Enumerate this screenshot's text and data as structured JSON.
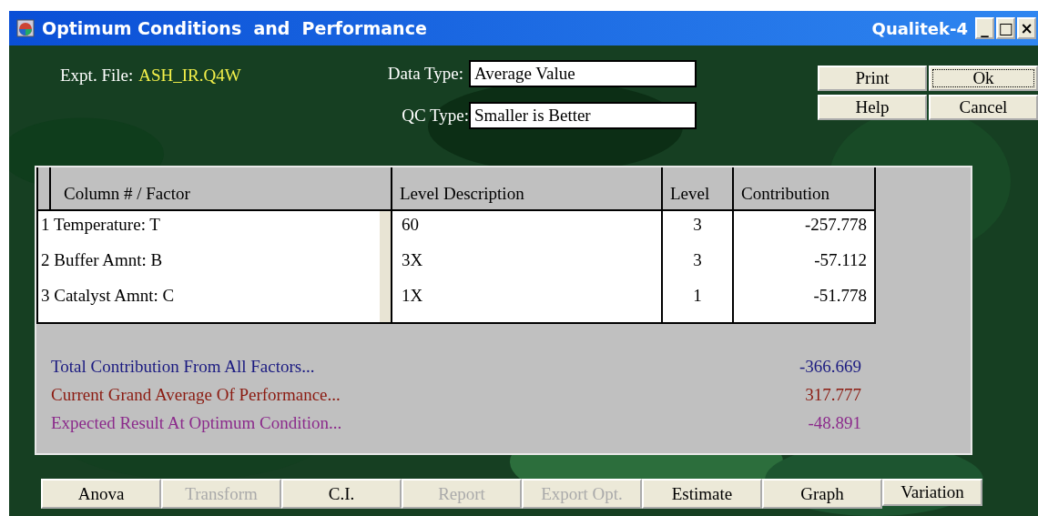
{
  "window": {
    "title": "Optimum Conditions  and  Performance",
    "app_name": "Qualitek-4",
    "controls": [
      "_",
      "□",
      "×"
    ]
  },
  "expt_file": {
    "label": "Expt. File:",
    "value": "ASH_IR.Q4W"
  },
  "data_type": {
    "label": "Data Type:",
    "value": "Average Value"
  },
  "qc_type": {
    "label": "QC Type:",
    "value": "Smaller is Better"
  },
  "side_buttons": [
    {
      "label": "Print",
      "focused": false
    },
    {
      "label": "Ok",
      "focused": true
    },
    {
      "label": "Help",
      "focused": false
    },
    {
      "label": "Cancel",
      "focused": false
    }
  ],
  "table": {
    "columns": [
      "Column # / Factor",
      "Level Description",
      "Level",
      "Contribution"
    ],
    "rows": [
      [
        "1 Temperature: T",
        "60",
        "3",
        "-257.778"
      ],
      [
        "2 Buffer Amnt: B",
        "3X",
        "3",
        "-57.112"
      ],
      [
        "3 Catalyst Amnt: C",
        "1X",
        "1",
        "-51.778"
      ]
    ]
  },
  "summary": [
    {
      "label": "Total Contribution From All Factors...",
      "value": "-366.669",
      "color": "#1a1a80"
    },
    {
      "label": "Current Grand Average Of Performance...",
      "value": "317.777",
      "color": "#8b1a10"
    },
    {
      "label": "Expected Result At Optimum Condition...",
      "value": "-48.891",
      "color": "#8b2a8b"
    }
  ],
  "bottom_buttons": [
    {
      "label": "Anova",
      "disabled": false
    },
    {
      "label": "Transform",
      "disabled": true
    },
    {
      "label": "C.I.",
      "disabled": false
    },
    {
      "label": "Report",
      "disabled": true
    },
    {
      "label": "Export Opt.",
      "disabled": true
    },
    {
      "label": "Estimate",
      "disabled": false
    },
    {
      "label": "Graph",
      "disabled": false
    },
    {
      "label": "Variation",
      "disabled": false
    }
  ]
}
